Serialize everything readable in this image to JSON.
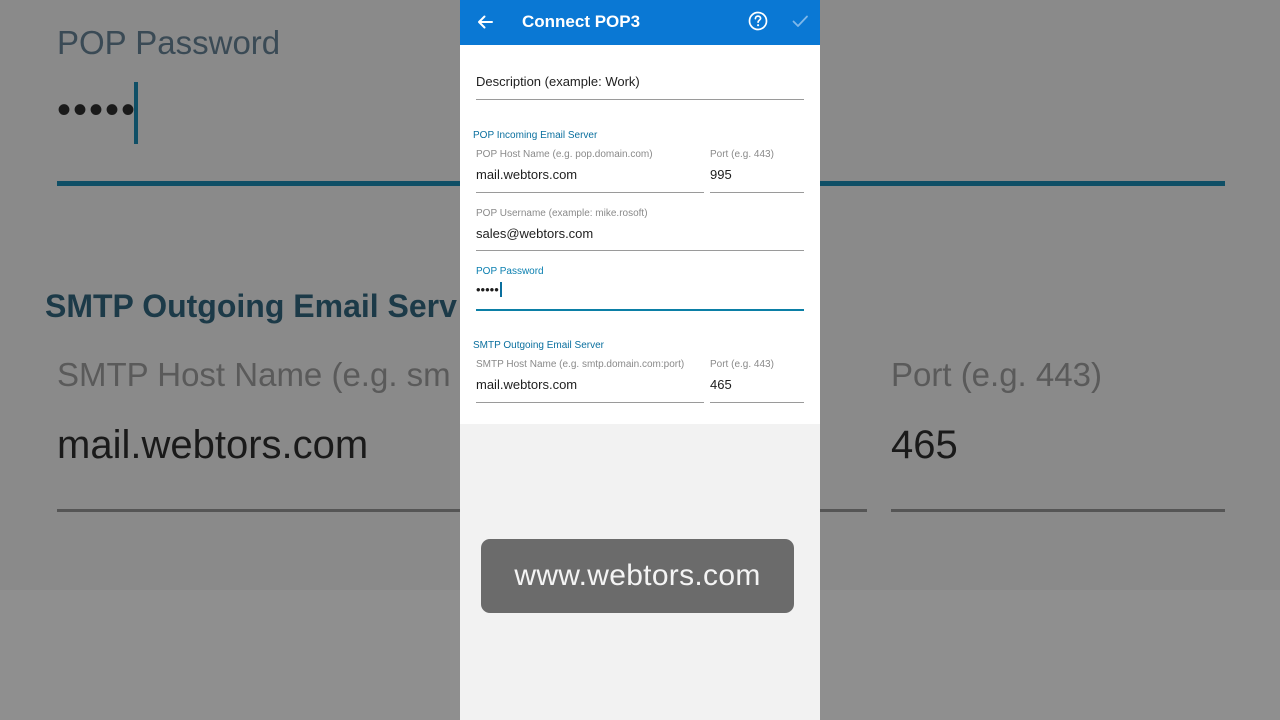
{
  "background": {
    "pop_password_label": "POP Password",
    "pop_password_dots": "•••••",
    "smtp_section_heading": "SMTP Outgoing Email Serv",
    "smtp_host_label": "SMTP Host Name (e.g. sm",
    "smtp_host_value": "mail.webtors.com",
    "smtp_port_label": "Port (e.g. 443)",
    "smtp_port_value": "465"
  },
  "appbar": {
    "title": "Connect POP3",
    "back_icon": "arrow-left-icon",
    "help_icon": "help-circle-icon",
    "save_icon": "check-icon",
    "color": "#0a78d4"
  },
  "form": {
    "description": {
      "placeholder": "Description (example: Work)",
      "value": ""
    },
    "pop_section": {
      "heading": "POP Incoming Email Server",
      "host_label": "POP Host Name (e.g. pop.domain.com)",
      "host_value": "mail.webtors.com",
      "port_label": "Port (e.g. 443)",
      "port_value": "995",
      "username_label": "POP Username (example: mike.rosoft)",
      "username_value": "sales@webtors.com",
      "password_label": "POP Password",
      "password_value": "•••••"
    },
    "smtp_section": {
      "heading": "SMTP Outgoing Email Server",
      "host_label": "SMTP Host Name (e.g. smtp.domain.com:port)",
      "host_value": "mail.webtors.com",
      "port_label": "Port (e.g. 443)",
      "port_value": "465"
    }
  },
  "watermark": {
    "text": "www.webtors.com"
  }
}
